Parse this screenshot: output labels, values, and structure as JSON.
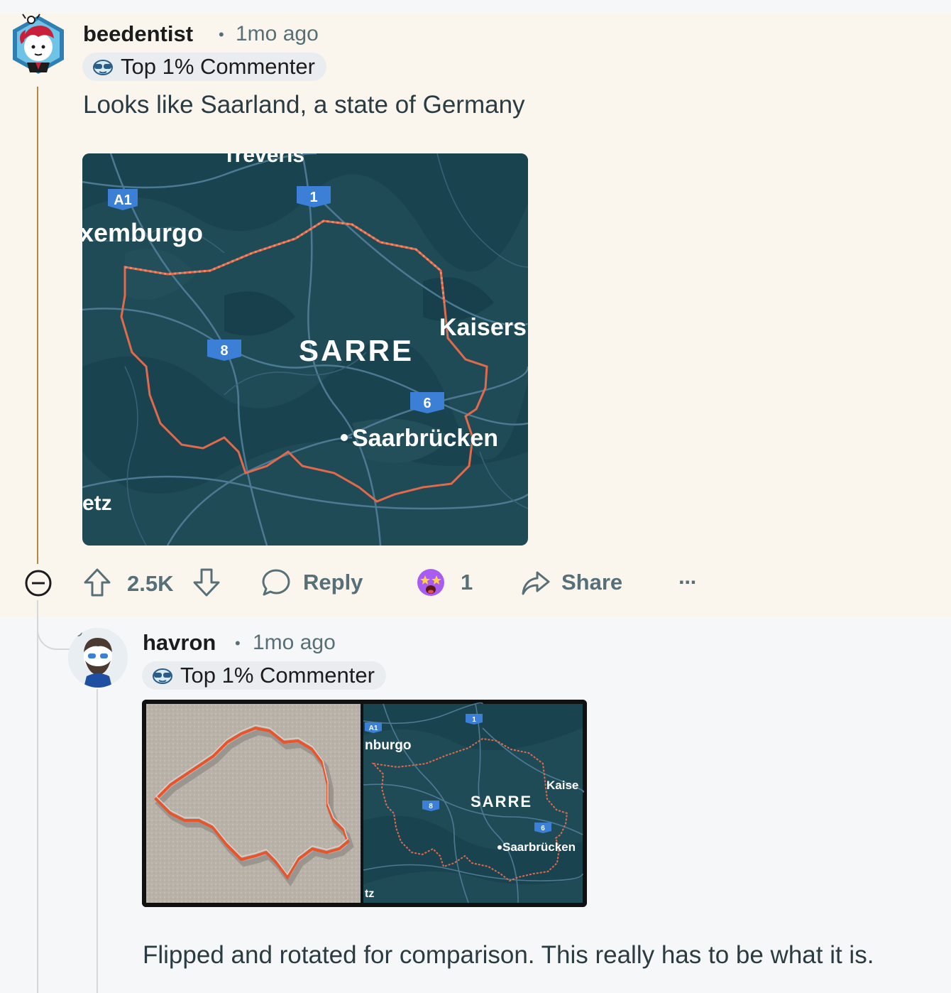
{
  "comments": [
    {
      "username": "beedentist",
      "separator": "•",
      "time": "1mo ago",
      "badge": "Top 1% Commenter",
      "text": "Looks like Saarland, a state of Germany",
      "map_labels": {
        "treveris": "Treveris",
        "a1": "A1",
        "route1": "1",
        "luxemburgo": "xemburgo",
        "kaisers": "Kaisersl",
        "route8": "8",
        "sarre": "SARRE",
        "route6": "6",
        "saarbrucken": "Saarbrücken",
        "metz": "etz"
      },
      "actions": {
        "upvote_count": "2.5K",
        "reply": "Reply",
        "award_count": "1",
        "share": "Share",
        "more": "···"
      }
    },
    {
      "username": "havron",
      "separator": "•",
      "time": "1mo ago",
      "badge": "Top 1% Commenter",
      "map_labels": {
        "a1": "A1",
        "route1": "1",
        "nburgo": "nburgo",
        "kaise": "Kaise",
        "route8": "8",
        "sarre": "SARRE",
        "route6": "6",
        "saarbrucken": "Saarbrücken",
        "tz": "tz"
      },
      "text": "Flipped and rotated for comparison. This really has to be what it is."
    }
  ],
  "colors": {
    "highlight_bg": "#faf6ee",
    "thread_line_active": "#b08a44",
    "meta_gray": "#576f76",
    "map_bg": "#1f4b57",
    "border_red": "#e06a4c",
    "route_blue": "#3b7fd6"
  },
  "icons": {
    "collapse": "minus-circle-icon",
    "upvote": "arrow-up-icon",
    "downvote": "arrow-down-icon",
    "reply": "speech-bubble-icon",
    "award": "starstruck-emoji-icon",
    "share": "share-arrow-icon",
    "badge": "sunglasses-icon"
  }
}
